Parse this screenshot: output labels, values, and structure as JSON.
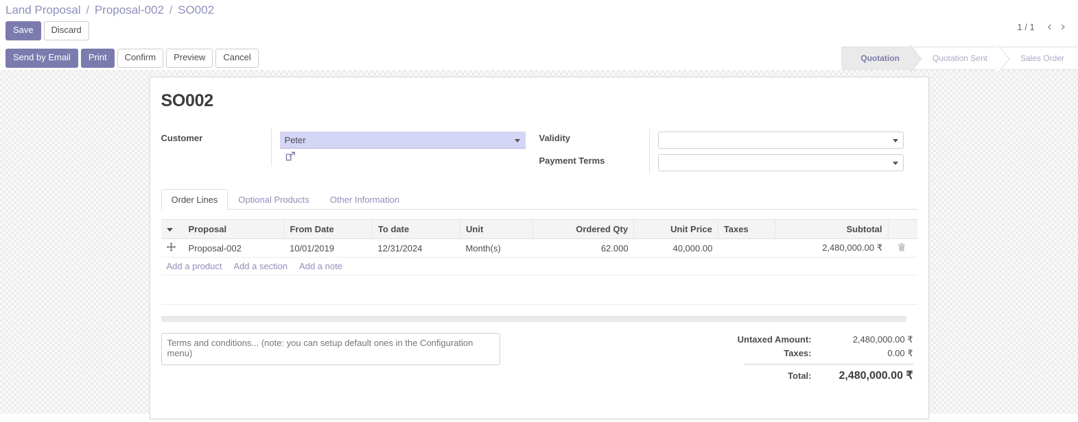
{
  "breadcrumb": {
    "items": [
      "Land Proposal",
      "Proposal-002",
      "SO002"
    ],
    "separator": "/"
  },
  "control_buttons": {
    "save_label": "Save",
    "discard_label": "Discard"
  },
  "pager": {
    "value": "1 / 1",
    "prev_icon": "chevron-left",
    "next_icon": "chevron-right"
  },
  "action_buttons": [
    {
      "label": "Send by Email",
      "style": "primary"
    },
    {
      "label": "Print",
      "style": "primary"
    },
    {
      "label": "Confirm",
      "style": "secondary"
    },
    {
      "label": "Preview",
      "style": "secondary"
    },
    {
      "label": "Cancel",
      "style": "secondary"
    }
  ],
  "statusbar": [
    {
      "label": "Quotation",
      "active": true
    },
    {
      "label": "Quotation Sent",
      "active": false
    },
    {
      "label": "Sales Order",
      "active": false
    }
  ],
  "record": {
    "title": "SO002"
  },
  "form": {
    "left": [
      {
        "label": "Customer",
        "value": "Peter",
        "placeholder": "",
        "filled": true,
        "has_external_link": true
      }
    ],
    "right": [
      {
        "label": "Validity",
        "value": "",
        "placeholder": "",
        "has_external_link": false
      },
      {
        "label": "Payment Terms",
        "value": "",
        "placeholder": "",
        "has_external_link": false
      }
    ]
  },
  "tabs": [
    {
      "label": "Order Lines",
      "active": true
    },
    {
      "label": "Optional Products",
      "active": false
    },
    {
      "label": "Other Information",
      "active": false
    }
  ],
  "order_lines": {
    "columns": [
      {
        "label": "Proposal",
        "align": "left"
      },
      {
        "label": "From Date",
        "align": "left"
      },
      {
        "label": "To date",
        "align": "left"
      },
      {
        "label": "Unit",
        "align": "left"
      },
      {
        "label": "Ordered Qty",
        "align": "right"
      },
      {
        "label": "Unit Price",
        "align": "right"
      },
      {
        "label": "Taxes",
        "align": "left"
      },
      {
        "label": "Subtotal",
        "align": "right"
      }
    ],
    "rows": [
      {
        "proposal": "Proposal-002",
        "from_date": "10/01/2019",
        "to_date": "12/31/2024",
        "unit": "Month(s)",
        "ordered_qty": "62.000",
        "unit_price": "40,000.00",
        "taxes": "",
        "subtotal": "2,480,000.00 ₹"
      }
    ],
    "add_links": [
      "Add a product",
      "Add a section",
      "Add a note"
    ]
  },
  "terms": {
    "value": "",
    "placeholder": "Terms and conditions... (note: you can setup default ones in the Configuration menu)"
  },
  "totals": {
    "untaxed_label": "Untaxed Amount:",
    "untaxed_value": "2,480,000.00 ₹",
    "taxes_label": "Taxes:",
    "taxes_value": "0.00 ₹",
    "total_label": "Total:",
    "total_value": "2,480,000.00 ₹"
  },
  "colors": {
    "primary": "#7c7bad",
    "link": "#8f8fbb",
    "text": "#4c4c4c",
    "field_selected_bg": "#d5d5f5"
  }
}
